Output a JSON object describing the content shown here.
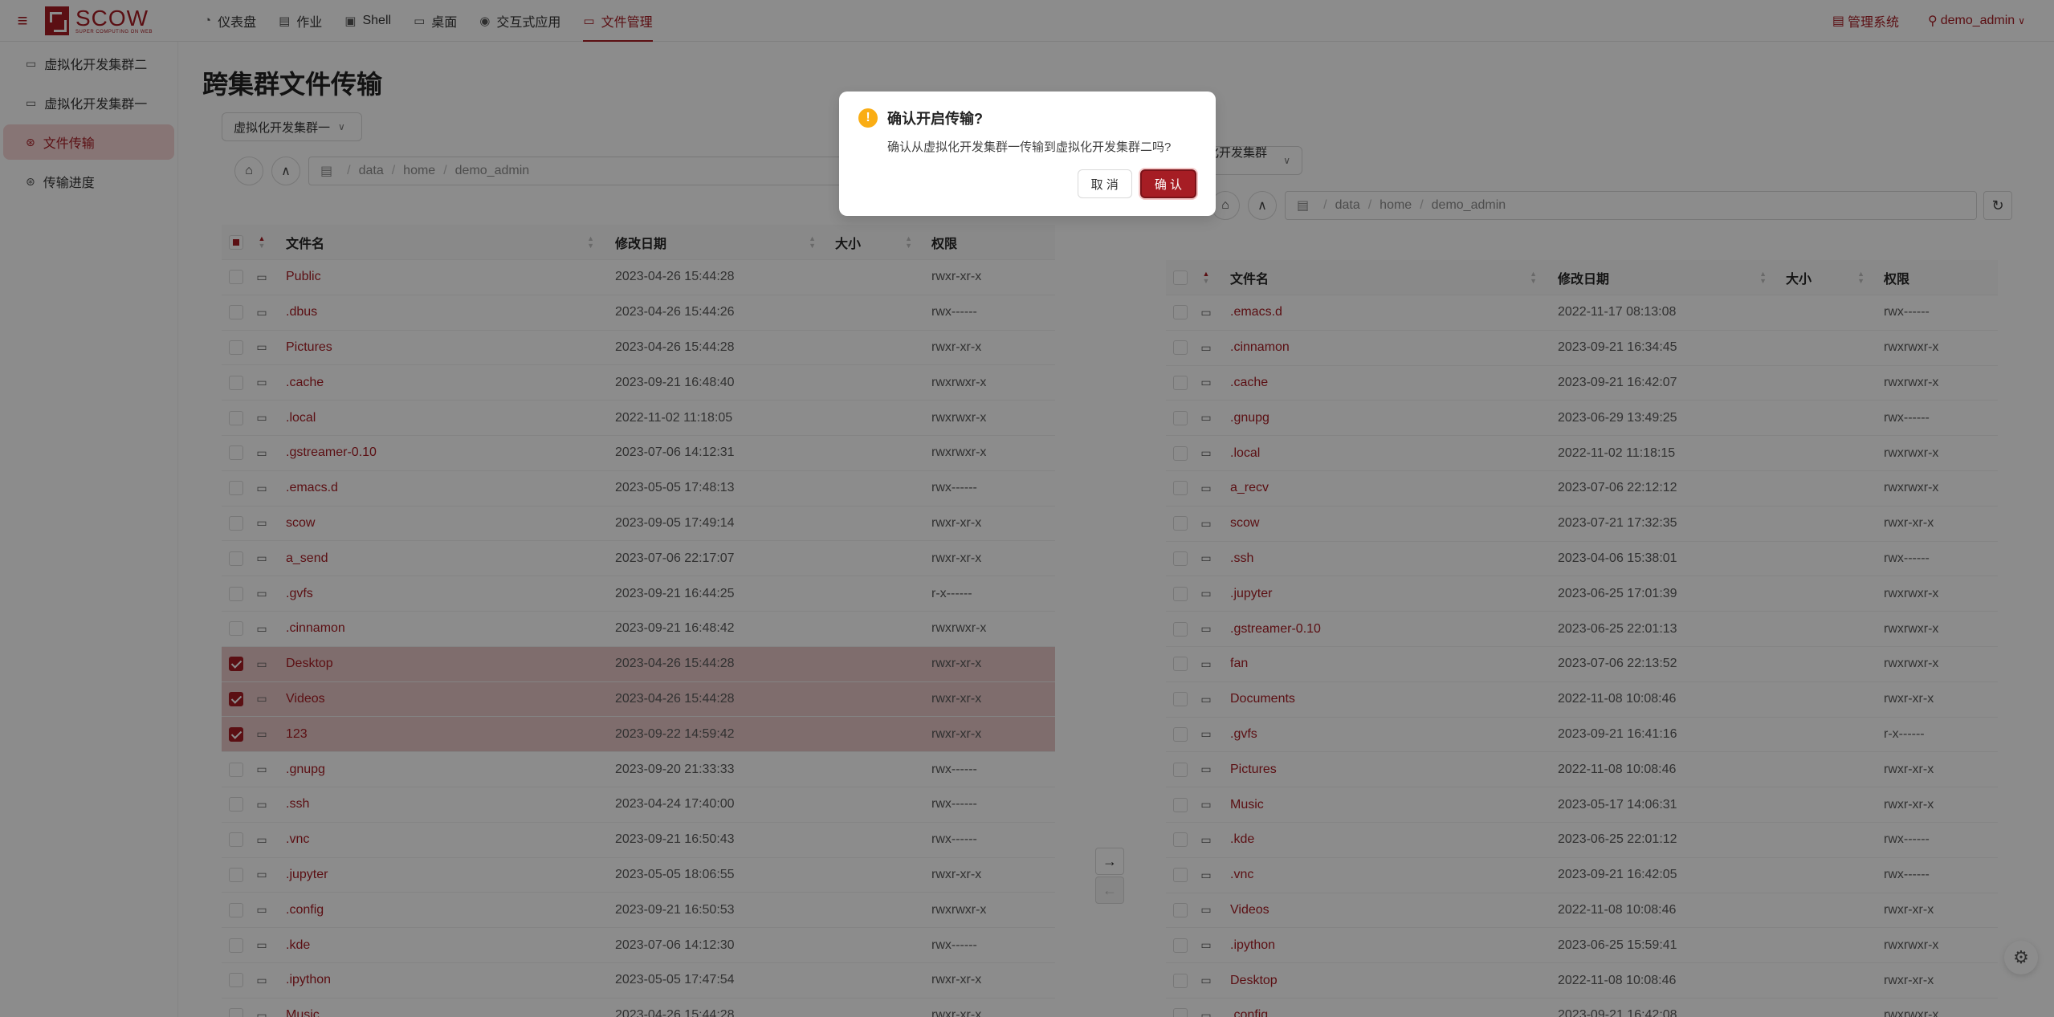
{
  "header": {
    "logo_text": "SCOW",
    "logo_sub": "SUPER COMPUTING ON WEB",
    "nav": [
      {
        "label": "仪表盘",
        "icon": "dashboard-icon",
        "glyph": "◔"
      },
      {
        "label": "作业",
        "icon": "document-icon",
        "glyph": "▤"
      },
      {
        "label": "Shell",
        "icon": "terminal-icon",
        "glyph": "▣"
      },
      {
        "label": "桌面",
        "icon": "desktop-icon",
        "glyph": "▭"
      },
      {
        "label": "交互式应用",
        "icon": "eye-icon",
        "glyph": "◉"
      },
      {
        "label": "文件管理",
        "icon": "folder-icon",
        "glyph": "▭"
      }
    ],
    "admin_link": "管理系统",
    "user": "demo_admin"
  },
  "sidebar": {
    "items": [
      {
        "label": "虚拟化开发集群二",
        "icon": "folder-icon"
      },
      {
        "label": "虚拟化开发集群一",
        "icon": "folder-icon"
      },
      {
        "label": "文件传输",
        "icon": "transfer-icon"
      },
      {
        "label": "传输进度",
        "icon": "progress-icon"
      }
    ]
  },
  "page": {
    "title": "跨集群文件传输"
  },
  "left": {
    "cluster": "虚拟化开发集群一",
    "path": [
      "data",
      "home",
      "demo_admin"
    ],
    "columns": {
      "name": "文件名",
      "date": "修改日期",
      "size": "大小",
      "perm": "权限"
    },
    "rows": [
      {
        "name": "Public",
        "date": "2023-04-26 15:44:28",
        "perm": "rwxr-xr-x",
        "checked": false
      },
      {
        "name": ".dbus",
        "date": "2023-04-26 15:44:26",
        "perm": "rwx------",
        "checked": false
      },
      {
        "name": "Pictures",
        "date": "2023-04-26 15:44:28",
        "perm": "rwxr-xr-x",
        "checked": false
      },
      {
        "name": ".cache",
        "date": "2023-09-21 16:48:40",
        "perm": "rwxrwxr-x",
        "checked": false
      },
      {
        "name": ".local",
        "date": "2022-11-02 11:18:05",
        "perm": "rwxrwxr-x",
        "checked": false
      },
      {
        "name": ".gstreamer-0.10",
        "date": "2023-07-06 14:12:31",
        "perm": "rwxrwxr-x",
        "checked": false
      },
      {
        "name": ".emacs.d",
        "date": "2023-05-05 17:48:13",
        "perm": "rwx------",
        "checked": false
      },
      {
        "name": "scow",
        "date": "2023-09-05 17:49:14",
        "perm": "rwxr-xr-x",
        "checked": false
      },
      {
        "name": "a_send",
        "date": "2023-07-06 22:17:07",
        "perm": "rwxr-xr-x",
        "checked": false
      },
      {
        "name": ".gvfs",
        "date": "2023-09-21 16:44:25",
        "perm": "r-x------",
        "checked": false
      },
      {
        "name": ".cinnamon",
        "date": "2023-09-21 16:48:42",
        "perm": "rwxrwxr-x",
        "checked": false
      },
      {
        "name": "Desktop",
        "date": "2023-04-26 15:44:28",
        "perm": "rwxr-xr-x",
        "checked": true
      },
      {
        "name": "Videos",
        "date": "2023-04-26 15:44:28",
        "perm": "rwxr-xr-x",
        "checked": true
      },
      {
        "name": "123",
        "date": "2023-09-22 14:59:42",
        "perm": "rwxr-xr-x",
        "checked": true
      },
      {
        "name": ".gnupg",
        "date": "2023-09-20 21:33:33",
        "perm": "rwx------",
        "checked": false
      },
      {
        "name": ".ssh",
        "date": "2023-04-24 17:40:00",
        "perm": "rwx------",
        "checked": false
      },
      {
        "name": ".vnc",
        "date": "2023-09-21 16:50:43",
        "perm": "rwx------",
        "checked": false
      },
      {
        "name": ".jupyter",
        "date": "2023-05-05 18:06:55",
        "perm": "rwxr-xr-x",
        "checked": false
      },
      {
        "name": ".config",
        "date": "2023-09-21 16:50:53",
        "perm": "rwxrwxr-x",
        "checked": false
      },
      {
        "name": ".kde",
        "date": "2023-07-06 14:12:30",
        "perm": "rwx------",
        "checked": false
      },
      {
        "name": ".ipython",
        "date": "2023-05-05 17:47:54",
        "perm": "rwxr-xr-x",
        "checked": false
      },
      {
        "name": "Music",
        "date": "2023-04-26 15:44:28",
        "perm": "rwxr-xr-x",
        "checked": false
      }
    ]
  },
  "right": {
    "cluster": "虚拟化开发集群二",
    "path": [
      "data",
      "home",
      "demo_admin"
    ],
    "columns": {
      "name": "文件名",
      "date": "修改日期",
      "size": "大小",
      "perm": "权限"
    },
    "rows": [
      {
        "name": ".emacs.d",
        "date": "2022-11-17 08:13:08",
        "perm": "rwx------"
      },
      {
        "name": ".cinnamon",
        "date": "2023-09-21 16:34:45",
        "perm": "rwxrwxr-x"
      },
      {
        "name": ".cache",
        "date": "2023-09-21 16:42:07",
        "perm": "rwxrwxr-x"
      },
      {
        "name": ".gnupg",
        "date": "2023-06-29 13:49:25",
        "perm": "rwx------"
      },
      {
        "name": ".local",
        "date": "2022-11-02 11:18:15",
        "perm": "rwxrwxr-x"
      },
      {
        "name": "a_recv",
        "date": "2023-07-06 22:12:12",
        "perm": "rwxrwxr-x"
      },
      {
        "name": "scow",
        "date": "2023-07-21 17:32:35",
        "perm": "rwxr-xr-x"
      },
      {
        "name": ".ssh",
        "date": "2023-04-06 15:38:01",
        "perm": "rwx------"
      },
      {
        "name": ".jupyter",
        "date": "2023-06-25 17:01:39",
        "perm": "rwxrwxr-x"
      },
      {
        "name": ".gstreamer-0.10",
        "date": "2023-06-25 22:01:13",
        "perm": "rwxrwxr-x"
      },
      {
        "name": "fan",
        "date": "2023-07-06 22:13:52",
        "perm": "rwxrwxr-x"
      },
      {
        "name": "Documents",
        "date": "2022-11-08 10:08:46",
        "perm": "rwxr-xr-x"
      },
      {
        "name": ".gvfs",
        "date": "2023-09-21 16:41:16",
        "perm": "r-x------"
      },
      {
        "name": "Pictures",
        "date": "2022-11-08 10:08:46",
        "perm": "rwxr-xr-x"
      },
      {
        "name": "Music",
        "date": "2023-05-17 14:06:31",
        "perm": "rwxr-xr-x"
      },
      {
        "name": ".kde",
        "date": "2023-06-25 22:01:12",
        "perm": "rwx------"
      },
      {
        "name": ".vnc",
        "date": "2023-09-21 16:42:05",
        "perm": "rwx------"
      },
      {
        "name": "Videos",
        "date": "2022-11-08 10:08:46",
        "perm": "rwxr-xr-x"
      },
      {
        "name": ".ipython",
        "date": "2023-06-25 15:59:41",
        "perm": "rwxrwxr-x"
      },
      {
        "name": "Desktop",
        "date": "2022-11-08 10:08:46",
        "perm": "rwxr-xr-x"
      },
      {
        "name": ".config",
        "date": "2023-09-21 16:42:08",
        "perm": "rwxrwxr-x"
      }
    ]
  },
  "modal": {
    "title": "确认开启传输?",
    "content": "确认从虚拟化开发集群一传输到虚拟化开发集群二吗?",
    "cancel": "取 消",
    "ok": "确 认"
  },
  "colors": {
    "brand": "#a61d24",
    "selected_row": "#e8c7c7",
    "warning": "#faad14"
  }
}
